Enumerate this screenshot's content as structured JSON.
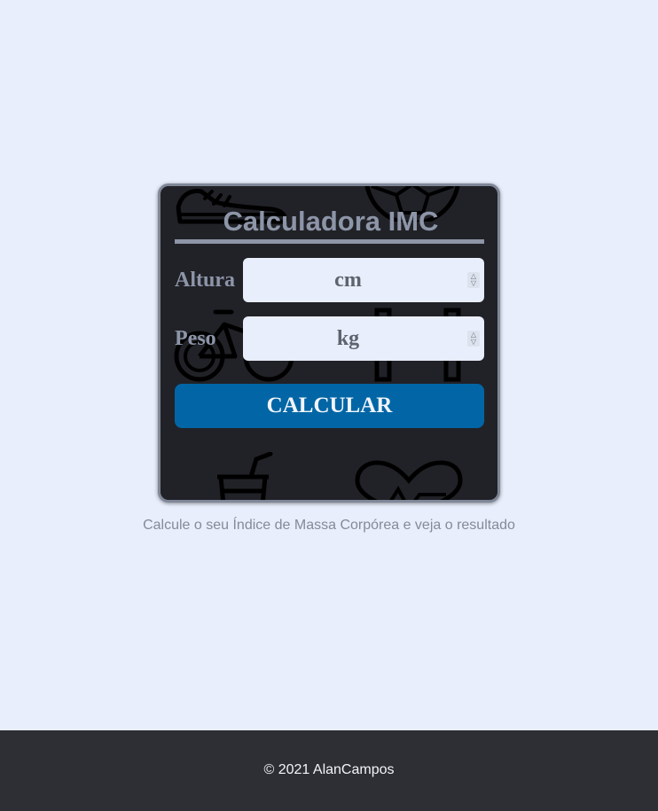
{
  "app": {
    "title": "Calculadora IMC"
  },
  "form": {
    "height_label": "Altura",
    "height_placeholder": "cm",
    "weight_label": "Peso",
    "weight_placeholder": "kg",
    "submit_label": "CALCULAR"
  },
  "caption": "Calcule o seu Índice de Massa Corpórea e veja o resultado",
  "footer": {
    "copyright": "© 2021 AlanCampos"
  },
  "background_icons": [
    "sneaker-icon",
    "soccer-ball-icon",
    "bicycle-icon",
    "dumbbell-icon",
    "juice-cup-icon",
    "heartbeat-icon"
  ],
  "colors": {
    "page_background": "#e8eefb",
    "card_background": "#212227",
    "card_border": "#7f8798",
    "accent_text": "#8d95a8",
    "button": "#0266a6",
    "footer_background": "#2d2f35"
  }
}
